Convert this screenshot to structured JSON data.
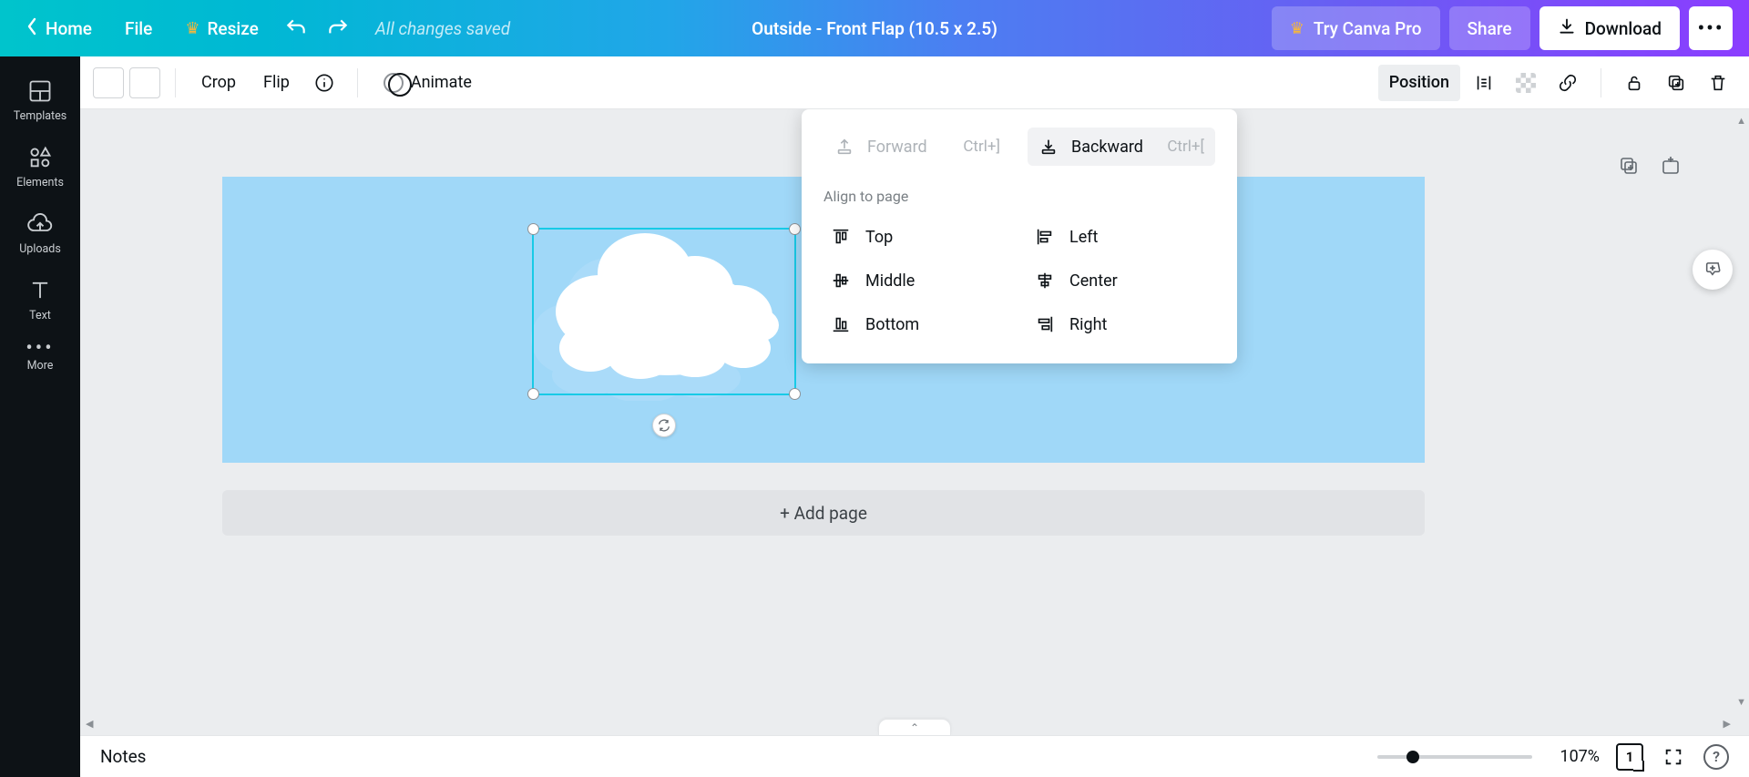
{
  "header": {
    "home": "Home",
    "file": "File",
    "resize": "Resize",
    "save_status": "All changes saved",
    "doc_title": "Outside - Front Flap (10.5 x 2.5)",
    "try_pro": "Try Canva Pro",
    "share": "Share",
    "download": "Download"
  },
  "sidebar": {
    "templates": "Templates",
    "elements": "Elements",
    "uploads": "Uploads",
    "text": "Text",
    "more": "More"
  },
  "toolbar2": {
    "crop": "Crop",
    "flip": "Flip",
    "animate": "Animate",
    "position": "Position"
  },
  "position_menu": {
    "forward": "Forward",
    "forward_kbd": "Ctrl+]",
    "backward": "Backward",
    "backward_kbd": "Ctrl+[",
    "align_title": "Align to page",
    "top": "Top",
    "middle": "Middle",
    "bottom": "Bottom",
    "left": "Left",
    "center": "Center",
    "right": "Right"
  },
  "canvas": {
    "add_page": "+ Add page"
  },
  "bottom": {
    "notes": "Notes",
    "zoom": "107%",
    "page_num": "1",
    "help": "?"
  }
}
